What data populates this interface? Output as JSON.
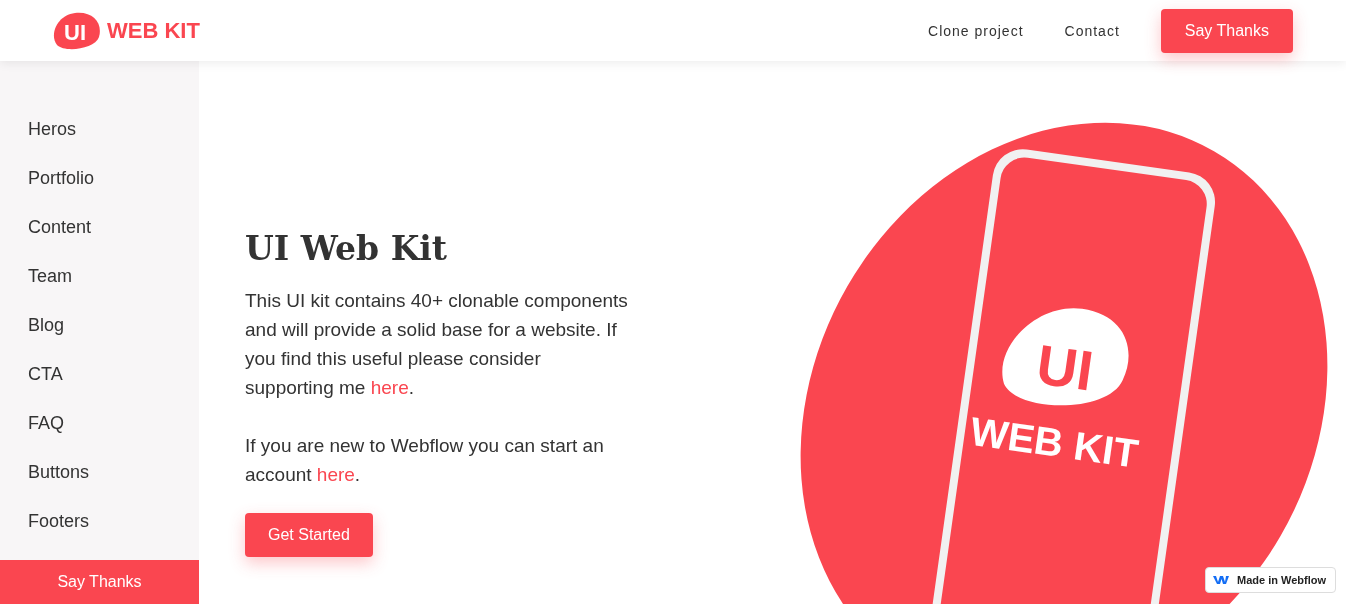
{
  "header": {
    "logo_mark": "UI",
    "logo_text": "WEB KIT",
    "nav": [
      "Clone project",
      "Contact"
    ],
    "button": "Say Thanks"
  },
  "sidebar": {
    "items": [
      "Heros",
      "Portfolio",
      "Content",
      "Team",
      "Blog",
      "CTA",
      "FAQ",
      "Buttons",
      "Footers"
    ],
    "button": "Say Thanks"
  },
  "hero": {
    "title": "UI Web Kit",
    "paragraphs": [
      {
        "text": "This UI kit contains 40+ clonable components and will provide a solid base for a website. If you find this useful please consider supporting me",
        "link": "here",
        "after": "."
      },
      {
        "text": "If you are new to Webflow you can start an account",
        "link": "here",
        "after": "."
      }
    ],
    "button": "Get Started"
  },
  "illustration": {
    "logo_mark": "UI",
    "logo_text": "WEB KIT"
  },
  "badge": {
    "label": "Made in Webflow"
  }
}
